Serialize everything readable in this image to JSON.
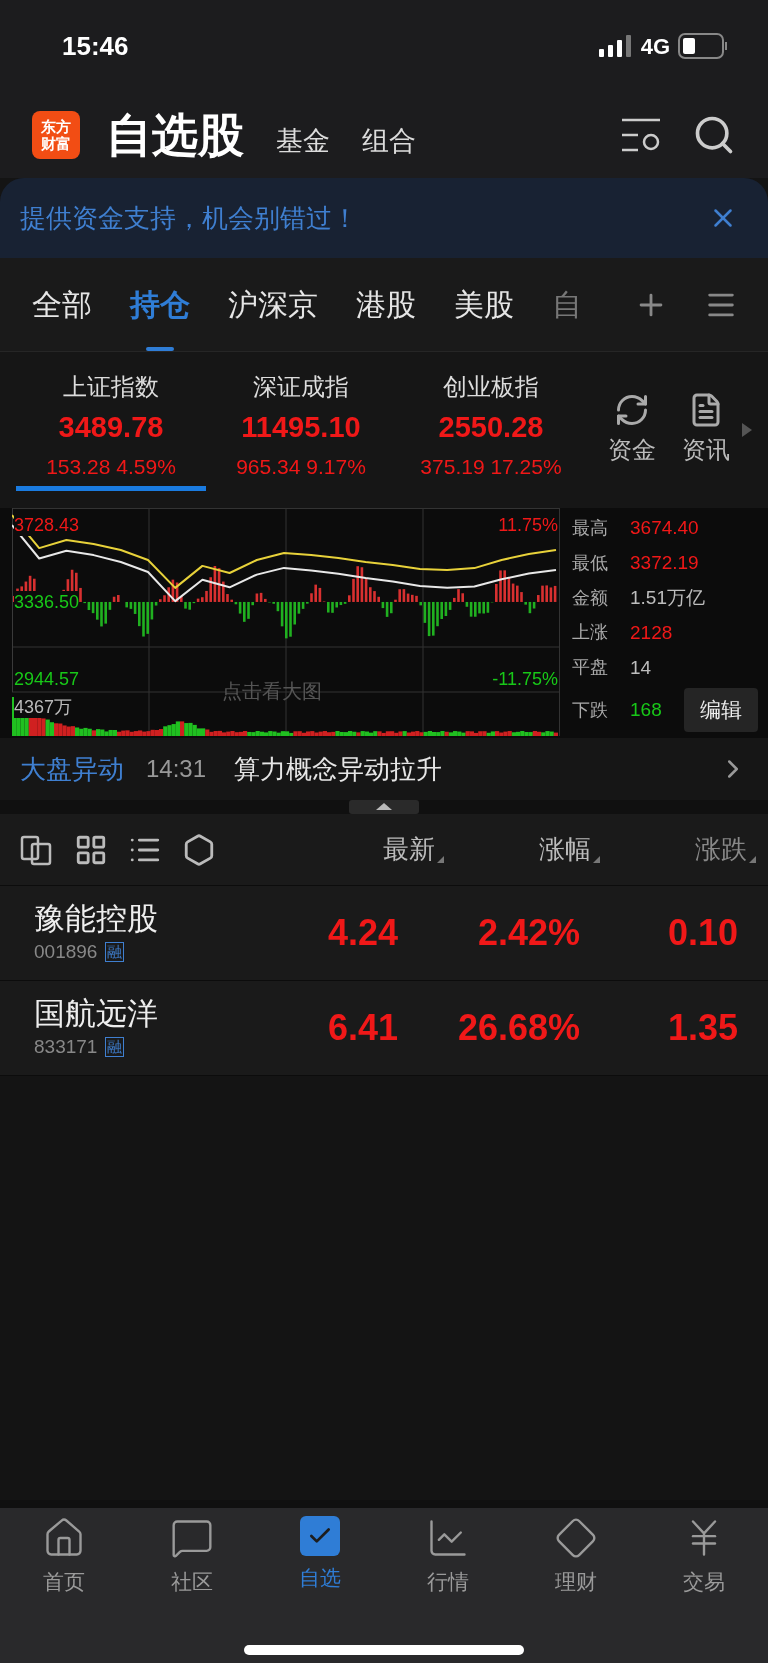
{
  "status_bar": {
    "time": "15:46",
    "network": "4G"
  },
  "header": {
    "logo": "东方财富",
    "title": "自选股",
    "links": [
      {
        "label": "基金",
        "selected": false
      },
      {
        "label": "组合",
        "selected": false
      }
    ]
  },
  "banner": {
    "text": "提供资金支持，机会别错过！"
  },
  "tabs": [
    {
      "label": "全部",
      "selected": false
    },
    {
      "label": "持仓",
      "selected": true
    },
    {
      "label": "沪深京",
      "selected": false
    },
    {
      "label": "港股",
      "selected": false
    },
    {
      "label": "美股",
      "selected": false
    },
    {
      "label": "自",
      "selected": false
    }
  ],
  "indices": [
    {
      "name": "上证指数",
      "value": "3489.78",
      "change": "153.28",
      "percent": "4.59%",
      "selected": true
    },
    {
      "name": "深证成指",
      "value": "11495.10",
      "change": "965.34",
      "percent": "9.17%",
      "selected": false
    },
    {
      "name": "创业板指",
      "value": "2550.28",
      "change": "375.19",
      "percent": "17.25%",
      "selected": false
    }
  ],
  "quick_actions": [
    {
      "kind": "funds",
      "label": "资金"
    },
    {
      "kind": "news",
      "label": "资讯"
    }
  ],
  "chart": {
    "top_percent": "11.75%",
    "bottom_percent": "-11.75%",
    "volume": "4367万",
    "hint": "点击看大图",
    "chart_data": {
      "type": "line",
      "ylim": [
        2878,
        3815
      ],
      "yticks": [
        {
          "value": 3728.43,
          "label": "3728.43"
        },
        {
          "value": 3336.5,
          "label": "3336.50"
        },
        {
          "value": 2944.57,
          "label": "2944.57"
        }
      ],
      "series": [
        {
          "color": "#e8d23a",
          "values": [
            3779,
            3611,
            3652,
            3632,
            3601,
            3550,
            3408,
            3520,
            3484,
            3550,
            3586,
            3576,
            3560,
            3540,
            3525,
            3504,
            3499,
            3509,
            3550,
            3581,
            3601
          ]
        },
        {
          "color": "#e8e8e8",
          "values": [
            3728,
            3558,
            3597,
            3575,
            3540,
            3489,
            3341,
            3450,
            3411,
            3476,
            3510,
            3497,
            3480,
            3458,
            3440,
            3418,
            3409,
            3415,
            3452,
            3481,
            3499
          ]
        }
      ]
    }
  },
  "stats": [
    {
      "label": "最高",
      "value": "3674.40",
      "color": "#f01818"
    },
    {
      "label": "最低",
      "value": "3372.19",
      "color": "#f01818"
    },
    {
      "label": "金额",
      "value": "1.51万亿",
      "color": "#bdbdbd"
    },
    {
      "label": "上涨",
      "value": "2128",
      "color": "#f01818"
    },
    {
      "label": "平盘",
      "value": "14",
      "color": "#bdbdbd"
    },
    {
      "label": "下跌",
      "value": "168",
      "color": "#18c818"
    }
  ],
  "edit_button": "编辑",
  "market_alert": {
    "label": "大盘异动",
    "time": "14:31",
    "text": "算力概念异动拉升"
  },
  "list_columns": [
    "最新",
    "涨幅",
    "涨跌"
  ],
  "stocks": [
    {
      "name": "豫能控股",
      "code": "001896",
      "tag": "融",
      "price": "4.24",
      "percent": "2.42%",
      "change": "0.10"
    },
    {
      "name": "国航远洋",
      "code": "833171",
      "tag": "融",
      "price": "6.41",
      "percent": "26.68%",
      "change": "1.35"
    }
  ],
  "nav": [
    {
      "kind": "home",
      "label": "首页",
      "selected": false
    },
    {
      "kind": "community",
      "label": "社区",
      "selected": false
    },
    {
      "kind": "watchlist",
      "label": "自选",
      "selected": true
    },
    {
      "kind": "market",
      "label": "行情",
      "selected": false
    },
    {
      "kind": "wealth",
      "label": "理财",
      "selected": false
    },
    {
      "kind": "trade",
      "label": "交易",
      "selected": false
    }
  ]
}
